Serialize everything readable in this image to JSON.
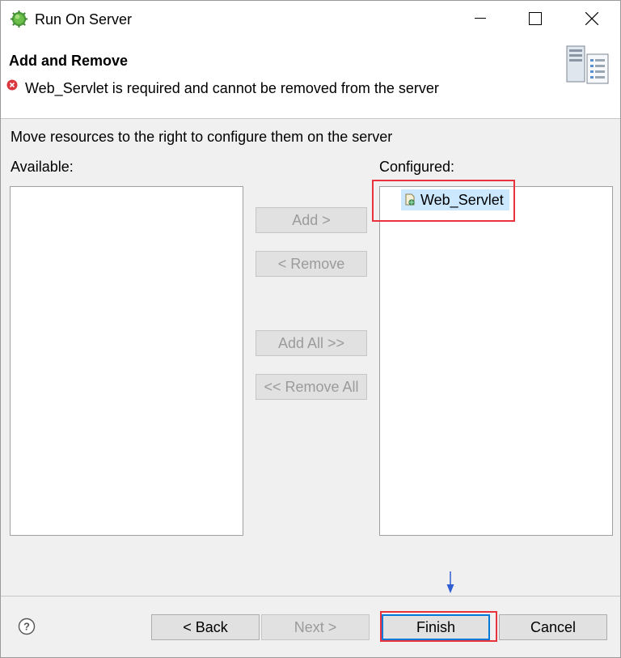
{
  "window": {
    "title": "Run On Server"
  },
  "header": {
    "title": "Add and Remove",
    "error_message": "Web_Servlet is required and cannot be removed from the server"
  },
  "main": {
    "instruction": "Move resources to the right to configure them on the server",
    "available_label": "Available:",
    "configured_label": "Configured:",
    "available_items": [],
    "configured_items": [
      {
        "label": "Web_Servlet",
        "icon": "web-project-icon",
        "selected": true
      }
    ],
    "buttons": {
      "add": "Add >",
      "remove": "< Remove",
      "add_all": "Add All >>",
      "remove_all": "<< Remove All"
    }
  },
  "footer": {
    "back": "< Back",
    "next": "Next >",
    "finish": "Finish",
    "cancel": "Cancel"
  },
  "colors": {
    "highlight_red": "#e8323c",
    "focus_blue": "#0078d7",
    "selection": "#cce8ff",
    "arrow_blue": "#2f5fd0"
  }
}
